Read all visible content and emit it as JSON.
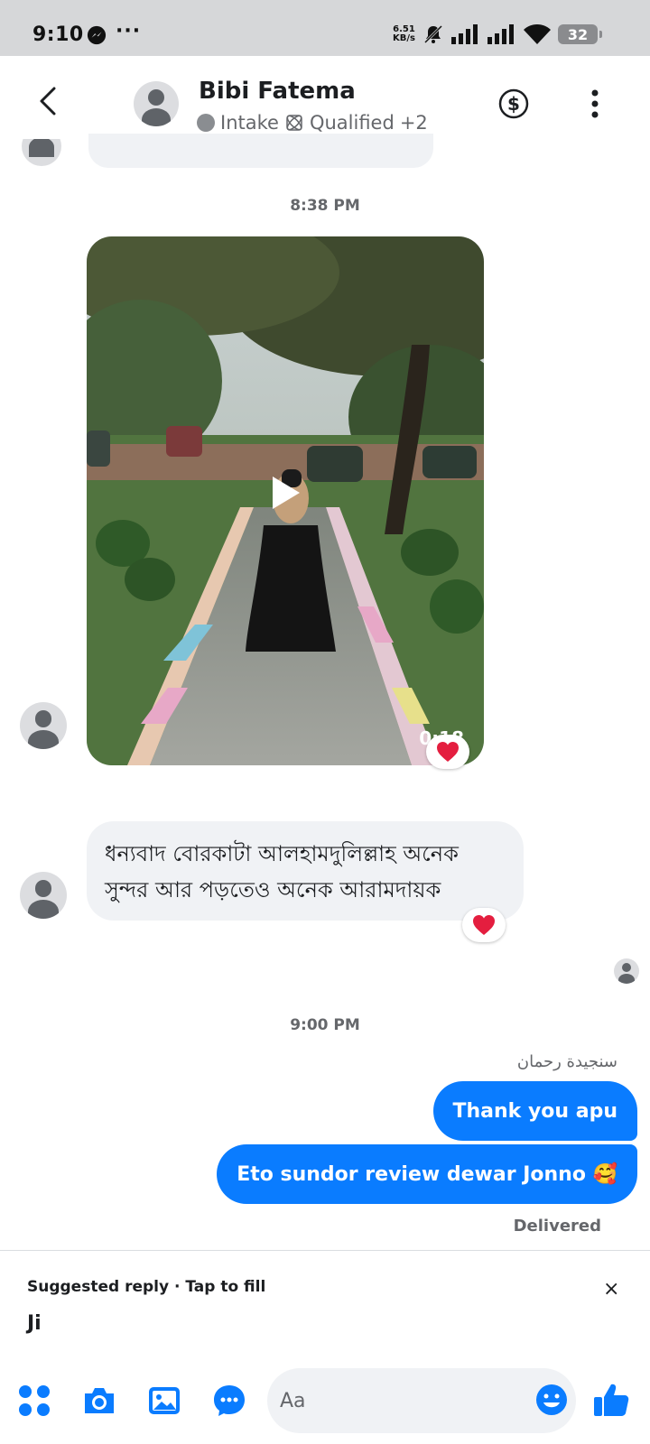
{
  "status_bar": {
    "time": "9:10",
    "overflow_dots": "···",
    "net_speed_value": "6.51",
    "net_speed_unit": "KB/s",
    "battery_level": "32"
  },
  "header": {
    "contact_name": "Bibi Fatema",
    "tag_primary": "Intake",
    "tag_secondary": "Qualified",
    "tag_more": "+2"
  },
  "messages": {
    "timestamp_1": "8:38 PM",
    "video_duration": "0:18",
    "incoming_text": "ধন্যবাদ বোরকাটা আলহামদুলিল্লাহ অনেক সুন্দর আর পড়তেও অনেক আরামদায়ক",
    "timestamp_2": "9:00 PM",
    "sender_name": "سنجيدة رحمان",
    "outgoing_1": "Thank you apu",
    "outgoing_2": "Eto sundor review dewar Jonno 🥰",
    "status": "Delivered"
  },
  "suggested_reply": {
    "label": "Suggested reply · Tap to fill",
    "close": "×",
    "text": "Ji"
  },
  "composer": {
    "placeholder": "Aa"
  },
  "colors": {
    "accent": "#0a7cff",
    "incoming_bubble": "#f0f2f5",
    "reaction": "#e41e3f"
  }
}
